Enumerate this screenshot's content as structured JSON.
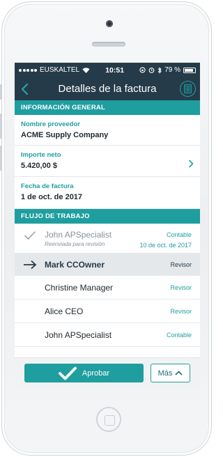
{
  "status_bar": {
    "carrier": "EUSKALTEL",
    "time": "10:51",
    "battery": "79 %"
  },
  "nav": {
    "title": "Detalles de la factura"
  },
  "general": {
    "header": "INFORMACIÓN GENERAL",
    "fields": [
      {
        "label": "Nombre proveedor",
        "value": "ACME Supply Company"
      },
      {
        "label": "Importe neto",
        "value": "5.420,00 $"
      },
      {
        "label": "Fecha de factura",
        "value": "1 de oct. de 2017"
      }
    ]
  },
  "workflow": {
    "header": "FLUJO DE TRABAJO",
    "steps": [
      {
        "name": "John APSpecialist",
        "sub": "Reenviada para revisión",
        "role": "Contable",
        "date": "10 de oct. de 2017"
      },
      {
        "name": "Mark CCOwner",
        "role": "Revisor"
      },
      {
        "name": "Christine Manager",
        "role": "Revisor"
      },
      {
        "name": "Alice CEO",
        "role": "Revisor"
      },
      {
        "name": "John APSpecialist",
        "role": "Contable"
      }
    ]
  },
  "actions": {
    "approve_label": "Aprobar",
    "more_label": "Más"
  },
  "colors": {
    "navbar": "#263b49",
    "accent": "#1f9ea0"
  }
}
